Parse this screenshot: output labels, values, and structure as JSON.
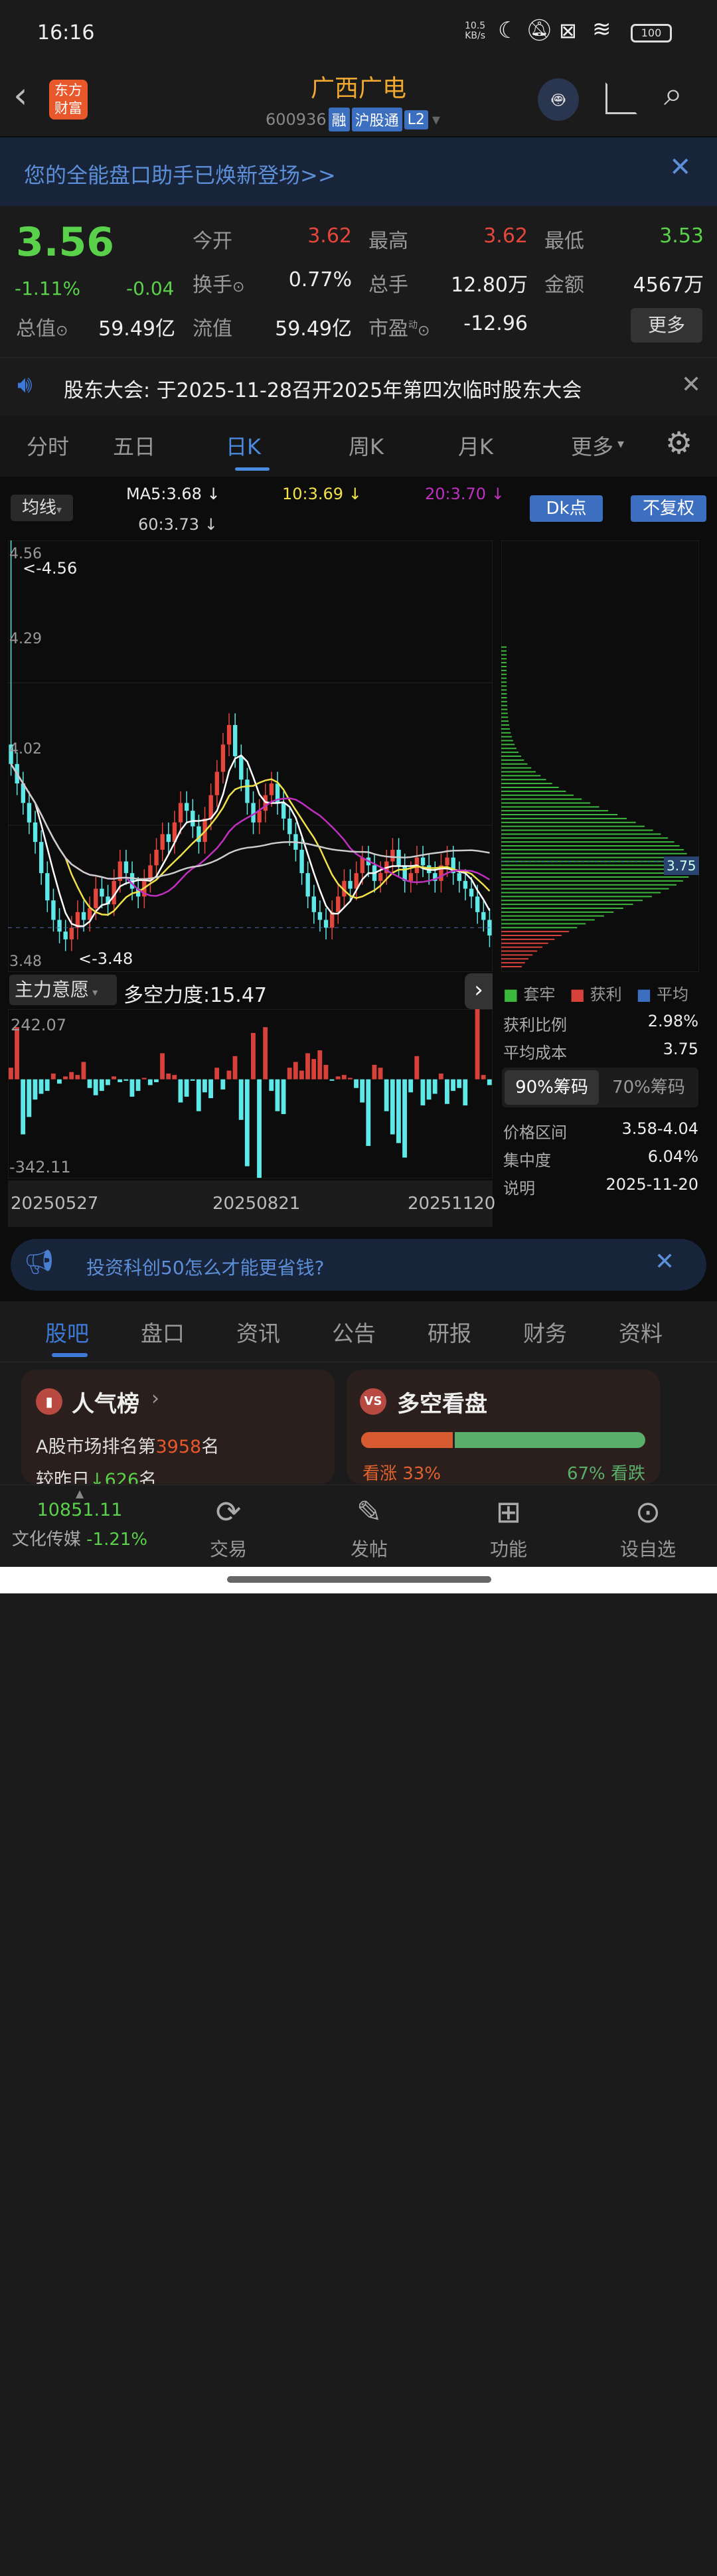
{
  "status": {
    "time": "16:16",
    "net_speed": "10.5",
    "net_unit": "KB/s",
    "battery": "100"
  },
  "header": {
    "logo": "东方财富",
    "title": "广西广电",
    "code": "600936",
    "tags": [
      "融",
      "沪股通",
      "L2"
    ]
  },
  "banner": {
    "text": "您的全能盘口助手已焕新登场>>"
  },
  "quote": {
    "price": "3.56",
    "change_pct": "-1.11%",
    "change": "-0.04",
    "fields": [
      {
        "label": "今开",
        "value": "3.62",
        "color": "r"
      },
      {
        "label": "最高",
        "value": "3.62",
        "color": "r"
      },
      {
        "label": "最低",
        "value": "3.53",
        "color": "g"
      },
      {
        "label": "换手",
        "value": "0.77%",
        "color": "w"
      },
      {
        "label": "总手",
        "value": "12.80万",
        "color": "w"
      },
      {
        "label": "金额",
        "value": "4567万",
        "color": "w"
      },
      {
        "label": "总值",
        "value": "59.49亿",
        "color": "w"
      },
      {
        "label": "流值",
        "value": "59.49亿",
        "color": "w"
      },
      {
        "label": "市盈",
        "sup": "动",
        "value": "-12.96",
        "color": "w"
      }
    ],
    "more": "更多"
  },
  "notice": {
    "text": "股东大会: 于2025-11-28召开2025年第四次临时股东大会"
  },
  "chart_tabs": [
    "分时",
    "五日",
    "日K",
    "周K",
    "月K",
    "更多"
  ],
  "active_tab": "日K",
  "ma": {
    "selector": "均线",
    "ma5": "MA5:3.68 ↓",
    "ma10": "10:3.69 ↓",
    "ma20": "20:3.70 ↓",
    "ma60": "60:3.73 ↓",
    "dk": "Dk点",
    "fq": "不复权"
  },
  "price_axis": {
    "top": "4.56",
    "l2": "4.29",
    "l3": "4.02",
    "bottom": "3.48",
    "max_mark": "<-4.56",
    "min_mark": "<-3.48",
    "ylim": [
      3.48,
      4.56
    ]
  },
  "chip": {
    "avg_label": "3.75",
    "legend": [
      "套牢",
      "获利",
      "平均"
    ],
    "legend_colors": [
      "#3cb83c",
      "#d8413a",
      "#3d6fc0"
    ],
    "rows": [
      {
        "label": "获利比例",
        "value": "2.98%"
      },
      {
        "label": "平均成本",
        "value": "3.75"
      }
    ],
    "tabs": [
      "90%筹码",
      "70%筹码"
    ],
    "rows2": [
      {
        "label": "价格区间",
        "value": "3.58-4.04"
      },
      {
        "label": "集中度",
        "value": "6.04%"
      },
      {
        "label": "说明",
        "value": "2025-11-20"
      }
    ]
  },
  "indicator": {
    "selector": "主力意愿",
    "title": "多空力度:15.47",
    "max": "242.07",
    "min": "-342.11"
  },
  "dates": [
    "20250527",
    "20250821",
    "20251120"
  ],
  "chart_data": {
    "type": "candlestick",
    "closes": [
      4.0,
      3.95,
      3.9,
      3.85,
      3.8,
      3.72,
      3.65,
      3.6,
      3.57,
      3.55,
      3.58,
      3.62,
      3.6,
      3.63,
      3.68,
      3.66,
      3.64,
      3.7,
      3.75,
      3.72,
      3.68,
      3.66,
      3.7,
      3.74,
      3.78,
      3.82,
      3.8,
      3.85,
      3.9,
      3.88,
      3.84,
      3.8,
      3.86,
      3.92,
      3.98,
      4.05,
      4.1,
      4.02,
      3.96,
      3.9,
      3.85,
      3.88,
      3.92,
      3.95,
      3.9,
      3.86,
      3.82,
      3.78,
      3.72,
      3.66,
      3.62,
      3.6,
      3.58,
      3.62,
      3.66,
      3.7,
      3.68,
      3.72,
      3.76,
      3.74,
      3.7,
      3.72,
      3.75,
      3.78,
      3.74,
      3.7,
      3.72,
      3.76,
      3.74,
      3.72,
      3.7,
      3.74,
      3.76,
      3.72,
      3.7,
      3.68,
      3.66,
      3.62,
      3.6,
      3.56
    ],
    "flow": [
      40,
      180,
      -190,
      -130,
      -70,
      -50,
      -40,
      20,
      -15,
      10,
      25,
      15,
      60,
      -30,
      -55,
      -40,
      -20,
      10,
      -10,
      -5,
      -60,
      -40,
      5,
      -20,
      -10,
      90,
      20,
      15,
      -80,
      -60,
      -5,
      -110,
      -45,
      -65,
      40,
      -35,
      30,
      80,
      -140,
      -300,
      160,
      -340,
      180,
      -40,
      -110,
      -120,
      40,
      60,
      30,
      90,
      70,
      100,
      50,
      -5,
      10,
      15,
      5,
      -30,
      -80,
      -230,
      50,
      40,
      -110,
      -190,
      -220,
      -270,
      -45,
      80,
      -90,
      -70,
      -50,
      20,
      -85,
      -40,
      -30,
      -90,
      0,
      242,
      15,
      -20
    ]
  },
  "ad": {
    "text": "投资科创50怎么才能更省钱?"
  },
  "bottom_tabs": [
    "股吧",
    "盘口",
    "资讯",
    "公告",
    "研报",
    "财务",
    "资料"
  ],
  "cards": {
    "rank_title": "人气榜",
    "rank_line1_pre": "A股市场排名第",
    "rank_num": "3958",
    "rank_line1_post": "名",
    "rank_line2_pre": "较昨日",
    "rank_delta": "626",
    "rank_line2_post": "名",
    "vs_title": "多空看盘",
    "bull": "看涨 33%",
    "bear": "67% 看跌",
    "bull_pct": 33
  },
  "nav": {
    "index_value": "10851.11",
    "index_name": "文化传媒",
    "index_change": "-1.21%",
    "items": [
      "交易",
      "发帖",
      "功能",
      "设自选"
    ]
  }
}
